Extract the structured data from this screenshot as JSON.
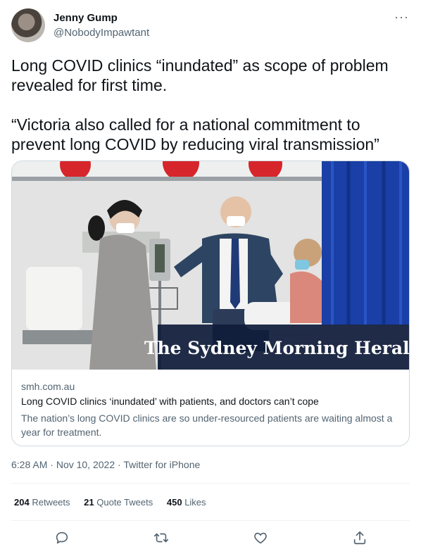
{
  "author": {
    "name": "Jenny Gump",
    "handle": "@NobodyImpawtant"
  },
  "more_label": "···",
  "tweet_text": "Long COVID clinics “inundated” as scope of problem revealed for first time.\n\n“Victoria also called for a national commitment to prevent long COVID by reducing viral transmission”",
  "card": {
    "domain": "smh.com.au",
    "title": "Long COVID clinics ‘inundated’ with patients, and doctors can’t cope",
    "description": "The nation’s long COVID clinics are so under-resourced patients are waiting almost a year for treatment.",
    "image_logo_text": "The Sydney Morning Herald"
  },
  "meta": {
    "time": "6:28 AM",
    "date": "Nov 10, 2022",
    "client": "Twitter for iPhone",
    "separator": " · "
  },
  "stats": {
    "retweets": {
      "count": "204",
      "label": "Retweets"
    },
    "quotes": {
      "count": "21",
      "label": "Quote Tweets"
    },
    "likes": {
      "count": "450",
      "label": "Likes"
    }
  },
  "actions": [
    "reply-icon",
    "retweet-icon",
    "like-icon",
    "share-icon"
  ],
  "colors": {
    "text": "#0f1419",
    "secondary": "#536471",
    "border": "#cfd9de",
    "curtain": "#1a3fa6"
  }
}
